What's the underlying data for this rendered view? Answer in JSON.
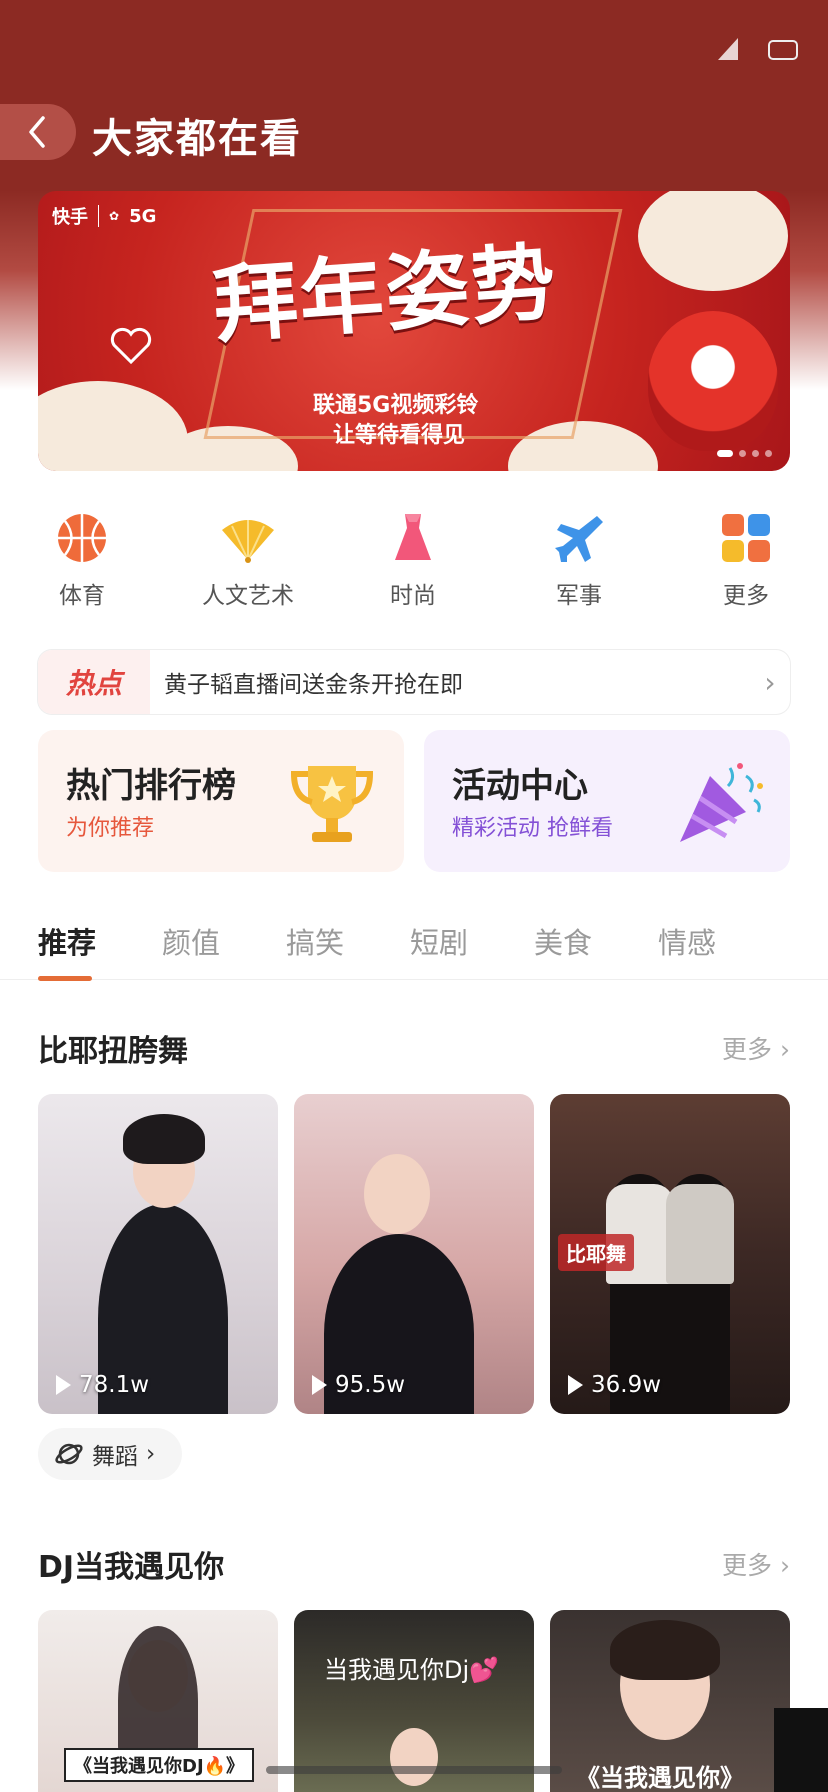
{
  "header": {
    "title": "大家都在看"
  },
  "banner": {
    "brand_kuaishou": "快手",
    "brand_5g": "5G",
    "headline": "拜年姿势",
    "sub_line1": "联通5G视频彩铃",
    "sub_line2": "让等待看得见"
  },
  "categories": [
    {
      "label": "体育",
      "icon": "basketball-icon"
    },
    {
      "label": "人文艺术",
      "icon": "fan-icon"
    },
    {
      "label": "时尚",
      "icon": "dress-icon"
    },
    {
      "label": "军事",
      "icon": "plane-icon"
    },
    {
      "label": "更多",
      "icon": "grid-icon"
    }
  ],
  "hot": {
    "tag": "热点",
    "text": "黄子韬直播间送金条开抢在即"
  },
  "cards": {
    "rank": {
      "title": "热门排行榜",
      "subtitle": "为你推荐"
    },
    "activity": {
      "title": "活动中心",
      "subtitle": "精彩活动 抢鲜看"
    }
  },
  "tabs": [
    "推荐",
    "颜值",
    "搞笑",
    "短剧",
    "美食",
    "情感"
  ],
  "section1": {
    "title": "比耶扭胯舞",
    "more": "更多",
    "videos": [
      {
        "plays": "78.1w"
      },
      {
        "plays": "95.5w"
      },
      {
        "plays": "36.9w",
        "overlay": "比耶舞"
      }
    ],
    "chip": "舞蹈"
  },
  "section2": {
    "title": "DJ当我遇见你",
    "more": "更多",
    "captions": [
      "《当我遇见你DJ🔥》",
      "当我遇见你Dj💕",
      "《当我遇见你》"
    ]
  },
  "colors": {
    "header": "#8c2a23",
    "accent_orange": "#e46c36",
    "hot_red": "#e1443f",
    "activity_purple": "#8451d6"
  }
}
